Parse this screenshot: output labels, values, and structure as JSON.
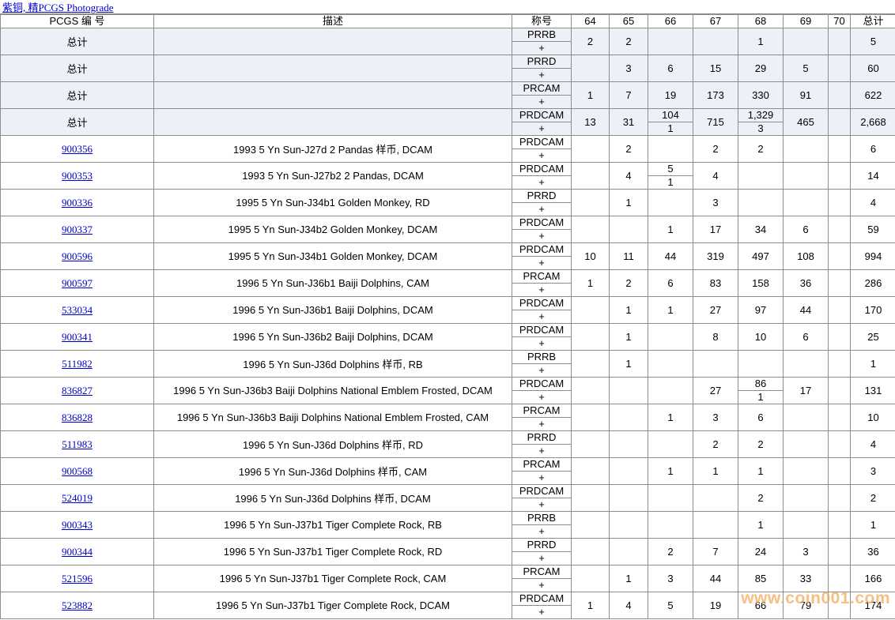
{
  "top_link": "紫铜, 精PCGS Photograde",
  "headers": [
    "PCGS 编 号",
    "描述",
    "称号",
    "64",
    "65",
    "66",
    "67",
    "68",
    "69",
    "70",
    "总计"
  ],
  "rows": [
    {
      "code": "总计",
      "link": false,
      "desc": "",
      "des": "PRRB",
      "plus": "+",
      "grades": [
        {
          "v": "2"
        },
        {
          "v": "2"
        },
        {
          "v": ""
        },
        {
          "v": ""
        },
        {
          "v": "1"
        },
        {
          "v": ""
        },
        {
          "v": ""
        }
      ],
      "total": "5"
    },
    {
      "code": "总计",
      "link": false,
      "desc": "",
      "des": "PRRD",
      "plus": "+",
      "grades": [
        {
          "v": ""
        },
        {
          "v": "3"
        },
        {
          "v": "6"
        },
        {
          "v": "15"
        },
        {
          "v": "29"
        },
        {
          "v": "5"
        },
        {
          "v": ""
        }
      ],
      "total": "60"
    },
    {
      "code": "总计",
      "link": false,
      "desc": "",
      "des": "PRCAM",
      "plus": "+",
      "grades": [
        {
          "v": "1"
        },
        {
          "v": "7"
        },
        {
          "v": "19"
        },
        {
          "v": "173"
        },
        {
          "v": "330"
        },
        {
          "v": "91"
        },
        {
          "v": ""
        }
      ],
      "total": "622"
    },
    {
      "code": "总计",
      "link": false,
      "desc": "",
      "des": "PRDCAM",
      "plus": "+",
      "grades": [
        {
          "v": "13"
        },
        {
          "v": "31"
        },
        {
          "v": "104",
          "p": "1"
        },
        {
          "v": "715"
        },
        {
          "v": "1,329",
          "p": "3"
        },
        {
          "v": "465"
        },
        {
          "v": ""
        }
      ],
      "total": "2,668"
    },
    {
      "code": "900356",
      "link": true,
      "desc": "1993 5 Yn Sun-J27d 2 Pandas 样币, DCAM",
      "des": "PRDCAM",
      "plus": "+",
      "grades": [
        {
          "v": ""
        },
        {
          "v": "2"
        },
        {
          "v": ""
        },
        {
          "v": "2"
        },
        {
          "v": "2"
        },
        {
          "v": ""
        },
        {
          "v": ""
        }
      ],
      "total": "6"
    },
    {
      "code": "900353",
      "link": true,
      "desc": "1993 5 Yn Sun-J27b2 2 Pandas, DCAM",
      "des": "PRDCAM",
      "plus": "+",
      "grades": [
        {
          "v": ""
        },
        {
          "v": "4"
        },
        {
          "v": "5",
          "p": "1"
        },
        {
          "v": "4"
        },
        {
          "v": ""
        },
        {
          "v": ""
        },
        {
          "v": ""
        }
      ],
      "total": "14"
    },
    {
      "code": "900336",
      "link": true,
      "desc": "1995 5 Yn Sun-J34b1 Golden Monkey, RD",
      "des": "PRRD",
      "plus": "+",
      "grades": [
        {
          "v": ""
        },
        {
          "v": "1"
        },
        {
          "v": ""
        },
        {
          "v": "3"
        },
        {
          "v": ""
        },
        {
          "v": ""
        },
        {
          "v": ""
        }
      ],
      "total": "4"
    },
    {
      "code": "900337",
      "link": true,
      "desc": "1995 5 Yn Sun-J34b2 Golden Monkey, DCAM",
      "des": "PRDCAM",
      "plus": "+",
      "grades": [
        {
          "v": ""
        },
        {
          "v": ""
        },
        {
          "v": "1"
        },
        {
          "v": "17"
        },
        {
          "v": "34"
        },
        {
          "v": "6"
        },
        {
          "v": ""
        }
      ],
      "total": "59"
    },
    {
      "code": "900596",
      "link": true,
      "desc": "1995 5 Yn Sun-J34b1 Golden Monkey, DCAM",
      "des": "PRDCAM",
      "plus": "+",
      "grades": [
        {
          "v": "10"
        },
        {
          "v": "11"
        },
        {
          "v": "44"
        },
        {
          "v": "319"
        },
        {
          "v": "497"
        },
        {
          "v": "108"
        },
        {
          "v": ""
        }
      ],
      "total": "994"
    },
    {
      "code": "900597",
      "link": true,
      "desc": "1996 5 Yn Sun-J36b1 Baiji Dolphins, CAM",
      "des": "PRCAM",
      "plus": "+",
      "grades": [
        {
          "v": "1"
        },
        {
          "v": "2"
        },
        {
          "v": "6"
        },
        {
          "v": "83"
        },
        {
          "v": "158"
        },
        {
          "v": "36"
        },
        {
          "v": ""
        }
      ],
      "total": "286"
    },
    {
      "code": "533034",
      "link": true,
      "desc": "1996 5 Yn Sun-J36b1 Baiji Dolphins, DCAM",
      "des": "PRDCAM",
      "plus": "+",
      "grades": [
        {
          "v": ""
        },
        {
          "v": "1"
        },
        {
          "v": "1"
        },
        {
          "v": "27"
        },
        {
          "v": "97"
        },
        {
          "v": "44"
        },
        {
          "v": ""
        }
      ],
      "total": "170"
    },
    {
      "code": "900341",
      "link": true,
      "desc": "1996 5 Yn Sun-J36b2 Baiji Dolphins, DCAM",
      "des": "PRDCAM",
      "plus": "+",
      "grades": [
        {
          "v": ""
        },
        {
          "v": "1"
        },
        {
          "v": ""
        },
        {
          "v": "8"
        },
        {
          "v": "10"
        },
        {
          "v": "6"
        },
        {
          "v": ""
        }
      ],
      "total": "25"
    },
    {
      "code": "511982",
      "link": true,
      "desc": "1996 5 Yn Sun-J36d Dolphins 样币, RB",
      "des": "PRRB",
      "plus": "+",
      "grades": [
        {
          "v": ""
        },
        {
          "v": "1"
        },
        {
          "v": ""
        },
        {
          "v": ""
        },
        {
          "v": ""
        },
        {
          "v": ""
        },
        {
          "v": ""
        }
      ],
      "total": "1"
    },
    {
      "code": "836827",
      "link": true,
      "desc": "1996 5 Yn Sun-J36b3 Baiji Dolphins National Emblem Frosted, DCAM",
      "des": "PRDCAM",
      "plus": "+",
      "grades": [
        {
          "v": ""
        },
        {
          "v": ""
        },
        {
          "v": ""
        },
        {
          "v": "27"
        },
        {
          "v": "86",
          "p": "1"
        },
        {
          "v": "17"
        },
        {
          "v": ""
        }
      ],
      "total": "131"
    },
    {
      "code": "836828",
      "link": true,
      "desc": "1996 5 Yn Sun-J36b3 Baiji Dolphins National Emblem Frosted, CAM",
      "des": "PRCAM",
      "plus": "+",
      "grades": [
        {
          "v": ""
        },
        {
          "v": ""
        },
        {
          "v": "1"
        },
        {
          "v": "3"
        },
        {
          "v": "6"
        },
        {
          "v": ""
        },
        {
          "v": ""
        }
      ],
      "total": "10"
    },
    {
      "code": "511983",
      "link": true,
      "desc": "1996 5 Yn Sun-J36d Dolphins 样币, RD",
      "des": "PRRD",
      "plus": "+",
      "grades": [
        {
          "v": ""
        },
        {
          "v": ""
        },
        {
          "v": ""
        },
        {
          "v": "2"
        },
        {
          "v": "2"
        },
        {
          "v": ""
        },
        {
          "v": ""
        }
      ],
      "total": "4"
    },
    {
      "code": "900568",
      "link": true,
      "desc": "1996 5 Yn Sun-J36d Dolphins 样币, CAM",
      "des": "PRCAM",
      "plus": "+",
      "grades": [
        {
          "v": ""
        },
        {
          "v": ""
        },
        {
          "v": "1"
        },
        {
          "v": "1"
        },
        {
          "v": "1"
        },
        {
          "v": ""
        },
        {
          "v": ""
        }
      ],
      "total": "3"
    },
    {
      "code": "524019",
      "link": true,
      "desc": "1996 5 Yn Sun-J36d Dolphins 样币, DCAM",
      "des": "PRDCAM",
      "plus": "+",
      "grades": [
        {
          "v": ""
        },
        {
          "v": ""
        },
        {
          "v": ""
        },
        {
          "v": ""
        },
        {
          "v": "2"
        },
        {
          "v": ""
        },
        {
          "v": ""
        }
      ],
      "total": "2"
    },
    {
      "code": "900343",
      "link": true,
      "desc": "1996 5 Yn Sun-J37b1 Tiger Complete Rock, RB",
      "des": "PRRB",
      "plus": "+",
      "grades": [
        {
          "v": ""
        },
        {
          "v": ""
        },
        {
          "v": ""
        },
        {
          "v": ""
        },
        {
          "v": "1"
        },
        {
          "v": ""
        },
        {
          "v": ""
        }
      ],
      "total": "1"
    },
    {
      "code": "900344",
      "link": true,
      "desc": "1996 5 Yn Sun-J37b1 Tiger Complete Rock, RD",
      "des": "PRRD",
      "plus": "+",
      "grades": [
        {
          "v": ""
        },
        {
          "v": ""
        },
        {
          "v": "2"
        },
        {
          "v": "7"
        },
        {
          "v": "24"
        },
        {
          "v": "3"
        },
        {
          "v": ""
        }
      ],
      "total": "36"
    },
    {
      "code": "521596",
      "link": true,
      "desc": "1996 5 Yn Sun-J37b1 Tiger Complete Rock, CAM",
      "des": "PRCAM",
      "plus": "+",
      "grades": [
        {
          "v": ""
        },
        {
          "v": "1"
        },
        {
          "v": "3"
        },
        {
          "v": "44"
        },
        {
          "v": "85"
        },
        {
          "v": "33"
        },
        {
          "v": ""
        }
      ],
      "total": "166"
    },
    {
      "code": "523882",
      "link": true,
      "desc": "1996 5 Yn Sun-J37b1 Tiger Complete Rock, DCAM",
      "des": "PRDCAM",
      "plus": "+",
      "grades": [
        {
          "v": "1"
        },
        {
          "v": "4"
        },
        {
          "v": "5"
        },
        {
          "v": "19"
        },
        {
          "v": "66"
        },
        {
          "v": "79"
        },
        {
          "v": ""
        }
      ],
      "total": "174"
    }
  ],
  "watermark": "www.coin001.com"
}
